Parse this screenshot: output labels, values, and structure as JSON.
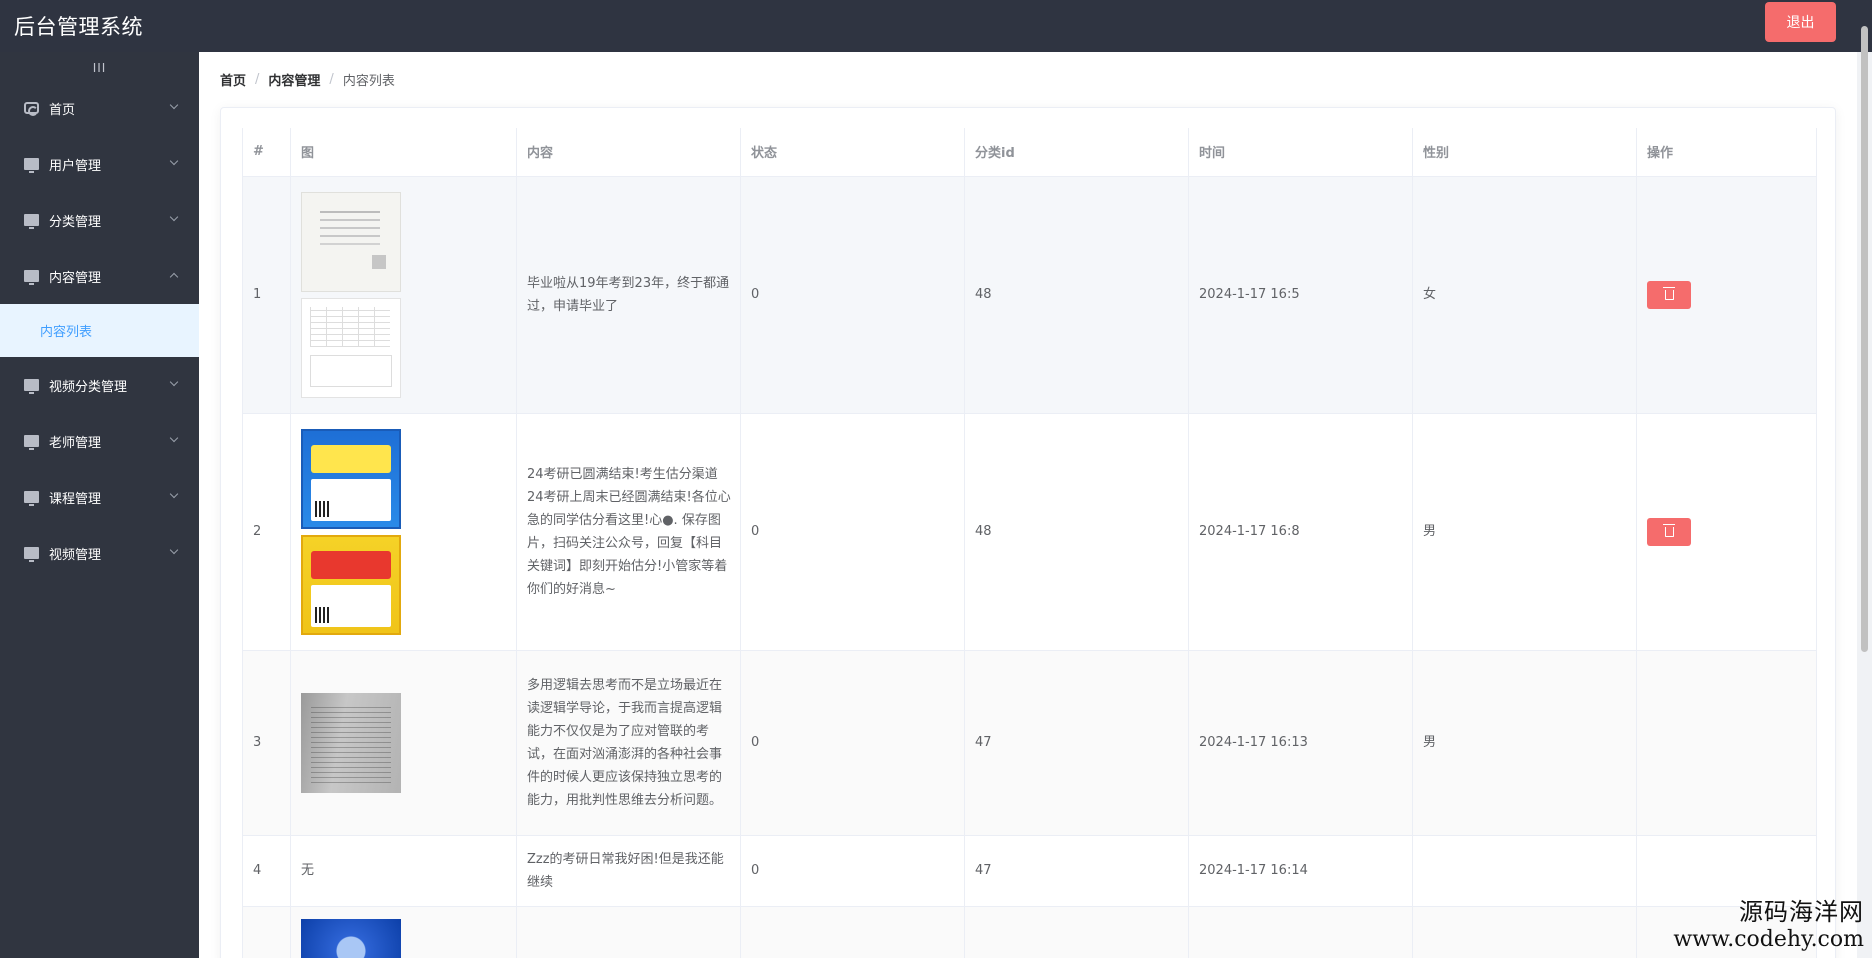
{
  "header": {
    "title": "后台管理系统",
    "logout_label": "退出"
  },
  "sidebar": {
    "toggle_glyph": "III",
    "items": [
      {
        "label": "首页",
        "icon": "home-icon",
        "expanded": false
      },
      {
        "label": "用户管理",
        "icon": "monitor-icon",
        "expanded": false
      },
      {
        "label": "分类管理",
        "icon": "monitor-icon",
        "expanded": false
      },
      {
        "label": "内容管理",
        "icon": "monitor-icon",
        "expanded": true
      },
      {
        "label": "视频分类管理",
        "icon": "monitor-icon",
        "expanded": false
      },
      {
        "label": "老师管理",
        "icon": "monitor-icon",
        "expanded": false
      },
      {
        "label": "课程管理",
        "icon": "monitor-icon",
        "expanded": false
      },
      {
        "label": "视频管理",
        "icon": "monitor-icon",
        "expanded": false
      }
    ],
    "submenu": {
      "label": "内容列表",
      "active": true
    }
  },
  "breadcrumb": [
    "首页",
    "内容管理",
    "内容列表"
  ],
  "table": {
    "columns": [
      "#",
      "图",
      "内容",
      "状态",
      "分类id",
      "时间",
      "性别",
      "操作"
    ],
    "rows": [
      {
        "index": "1",
        "content": "毕业啦从19年考到23年，终于都通过，申请毕业了",
        "status": "0",
        "category_id": "48",
        "time": "2024-1-17 16:5",
        "gender": "女",
        "images": "doc"
      },
      {
        "index": "2",
        "content": "24考研已圆满结束!考生估分渠道24考研上周末已经圆满结束!各位心急的同学估分看这里!心●. 保存图片，扫码关注公众号，回复【科目关键词】即刻开始估分!小管家等着你们的好消息~",
        "status": "0",
        "category_id": "48",
        "time": "2024-1-17 16:8",
        "gender": "男",
        "images": "posters"
      },
      {
        "index": "3",
        "content": "多用逻辑去思考而不是立场最近在读逻辑学导论，于我而言提高逻辑能力不仅仅是为了应对管联的考试，在面对汹涌澎湃的各种社会事件的时候人更应该保持独立思考的能力，用批判性思维去分析问题。",
        "status": "0",
        "category_id": "47",
        "time": "2024-1-17 16:13",
        "gender": "男",
        "images": "book"
      },
      {
        "index": "4",
        "image_text": "无",
        "content": "Zzz的考研日常我好困!但是我还能继续",
        "status": "0",
        "category_id": "47",
        "time": "2024-1-17 16:14",
        "gender": "",
        "images": "none"
      },
      {
        "index": "",
        "content": "",
        "status": "",
        "category_id": "",
        "time": "",
        "gender": "",
        "images": "photo"
      }
    ]
  },
  "watermark": {
    "name": "源码海洋网",
    "url": "www.codehy.com"
  },
  "colors": {
    "header_bg": "#2f3441",
    "sidebar_bg": "#303540",
    "danger": "#f56c6c",
    "active": "#409eff"
  }
}
